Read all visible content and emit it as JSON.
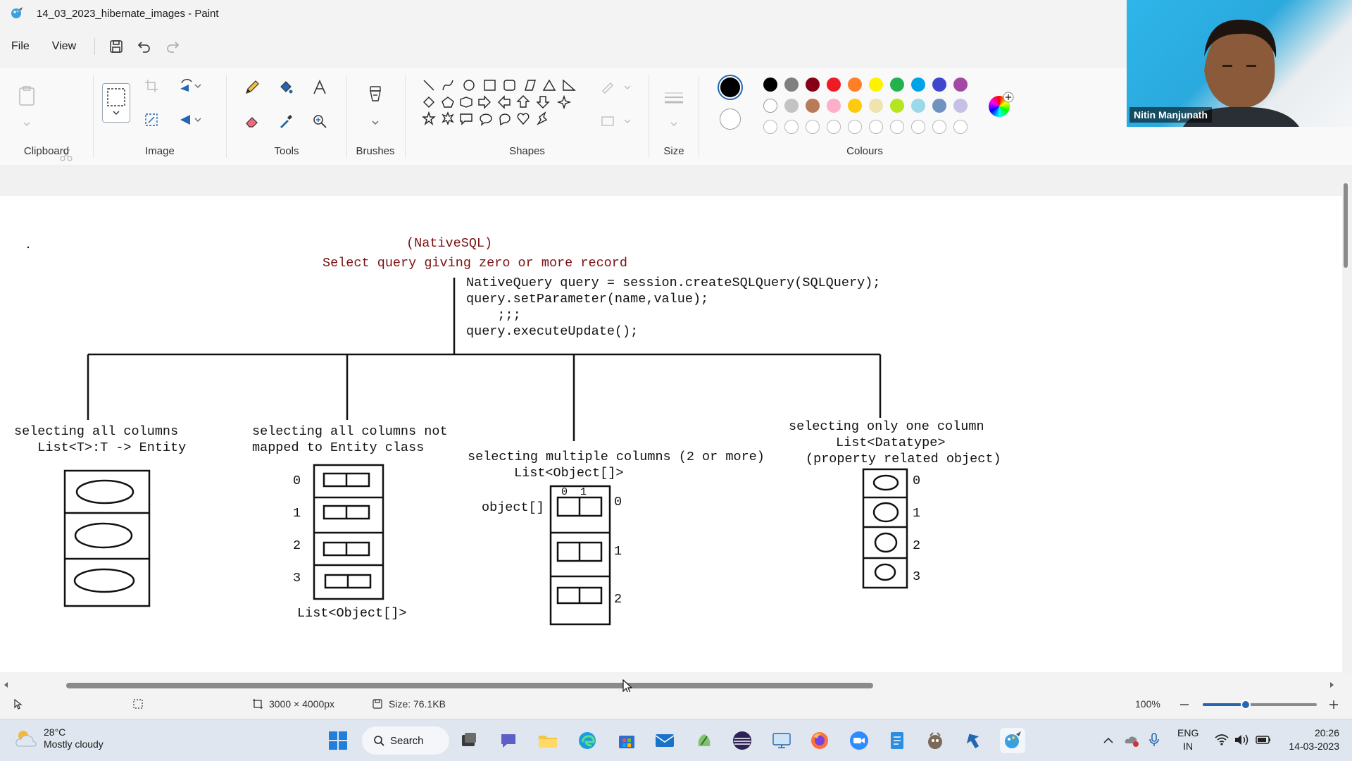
{
  "window": {
    "title": "14_03_2023_hibernate_images - Paint"
  },
  "menu": {
    "file": "File",
    "view": "View"
  },
  "ribbon": {
    "groups": {
      "clipboard": "Clipboard",
      "image": "Image",
      "tools": "Tools",
      "brushes": "Brushes",
      "shapes": "Shapes",
      "size": "Size",
      "colours": "Colours"
    },
    "colours_row1": [
      "#000000",
      "#7f7f7f",
      "#880015",
      "#ed1c24",
      "#ff7f27",
      "#fff200",
      "#22b14c",
      "#00a2e8",
      "#3f48cc",
      "#a349a4"
    ],
    "colours_row2": [
      "#ffffff",
      "#c3c3c3",
      "#b97a57",
      "#ffaec9",
      "#ffc90e",
      "#efe4b0",
      "#b5e61d",
      "#99d9ea",
      "#7092be",
      "#c8bfe7"
    ],
    "primary_colour": "#000000",
    "secondary_colour": "#ffffff"
  },
  "drawing": {
    "heading": "(NativeSQL)",
    "subheading": "Select query giving zero or more record",
    "code": [
      "NativeQuery query = session.createSQLQuery(SQLQuery);",
      "query.setParameter(name,value);",
      "    ;;;",
      "query.executeUpdate();"
    ],
    "branch1": {
      "line1": "selecting all columns",
      "line2": "   List<T>:T -> Entity"
    },
    "branch2": {
      "line1": "selecting all columns not",
      "line2": "mapped to Entity class",
      "caption": "List<Object[]>",
      "indexes": [
        "0",
        "1",
        "2",
        "3"
      ]
    },
    "branch3": {
      "line1": "selecting multiple columns (2 or more)",
      "line2": "List<Object[]>",
      "array_label": "object[]",
      "inner_indexes": "0  1",
      "indexes": [
        "0",
        "1",
        "2"
      ]
    },
    "branch4": {
      "line1": "selecting only one column",
      "line2": "List<Datatype>",
      "line3": "(property related object)",
      "indexes": [
        "0",
        "1",
        "2",
        "3"
      ]
    }
  },
  "statusbar": {
    "dimensions": "3000 × 4000px",
    "size": "Size: 76.1KB",
    "zoom": "100%"
  },
  "taskbar": {
    "weather_temp": "28°C",
    "weather_desc": "Mostly cloudy",
    "search": "Search",
    "lang1": "ENG",
    "lang2": "IN",
    "time": "20:26",
    "date": "14-03-2023"
  },
  "webcam": {
    "name": "Nitin Manjunath"
  }
}
